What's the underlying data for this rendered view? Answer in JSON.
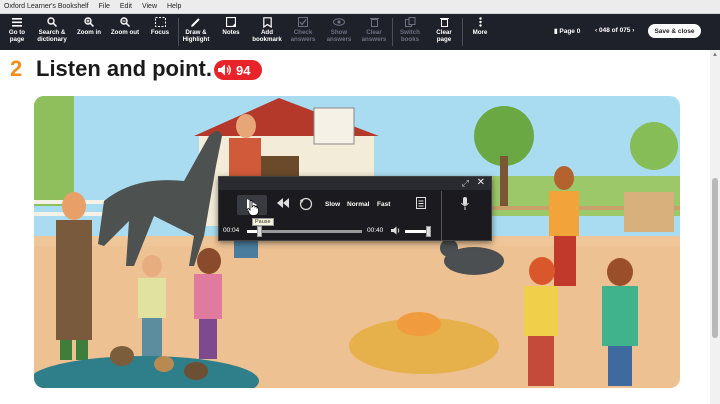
{
  "window": {
    "title": "Oxford Learner's Bookshelf"
  },
  "menu": [
    "File",
    "Edit",
    "View",
    "Help"
  ],
  "toolbar": {
    "items": [
      {
        "label1": "Go to",
        "label2": "page",
        "icon": "list-icon",
        "enabled": true
      },
      {
        "label1": "Search &",
        "label2": "dictionary",
        "icon": "search-icon",
        "enabled": true
      },
      {
        "label1": "Zoom in",
        "label2": "",
        "icon": "zoom-in-icon",
        "enabled": true
      },
      {
        "label1": "Zoom out",
        "label2": "",
        "icon": "zoom-out-icon",
        "enabled": true
      },
      {
        "label1": "Focus",
        "label2": "",
        "icon": "focus-icon",
        "enabled": true
      },
      {
        "label1": "Draw &",
        "label2": "Highlight",
        "icon": "pen-icon",
        "enabled": true
      },
      {
        "label1": "Notes",
        "label2": "",
        "icon": "note-icon",
        "enabled": true
      },
      {
        "label1": "Add",
        "label2": "bookmark",
        "icon": "bookmark-icon",
        "enabled": true
      },
      {
        "label1": "Check",
        "label2": "answers",
        "icon": "check-icon",
        "enabled": false
      },
      {
        "label1": "Show",
        "label2": "answers",
        "icon": "eye-icon",
        "enabled": false
      },
      {
        "label1": "Clear",
        "label2": "answers",
        "icon": "trash-icon",
        "enabled": false
      },
      {
        "label1": "Switch",
        "label2": "books",
        "icon": "books-icon",
        "enabled": false
      },
      {
        "label1": "Clear",
        "label2": "page",
        "icon": "trash-icon",
        "enabled": true
      },
      {
        "label1": "More",
        "label2": "",
        "icon": "more-icon",
        "enabled": true
      }
    ],
    "page_indicator": "Page 0",
    "page_nav": "048 of 075",
    "save_label": "Save & close"
  },
  "exercise": {
    "number": "2",
    "title": "Listen and point.",
    "audio_track": "94"
  },
  "player": {
    "speeds": [
      "Slow",
      "Normal",
      "Fast"
    ],
    "time_current": "00:04",
    "time_total": "00:40",
    "progress": 0.1,
    "volume": 0.9,
    "tooltip": "Pause"
  },
  "colors": {
    "toolbar_bg": "#1e2129",
    "exercise_number": "#f28c1a",
    "audio_badge": "#e8232a"
  }
}
